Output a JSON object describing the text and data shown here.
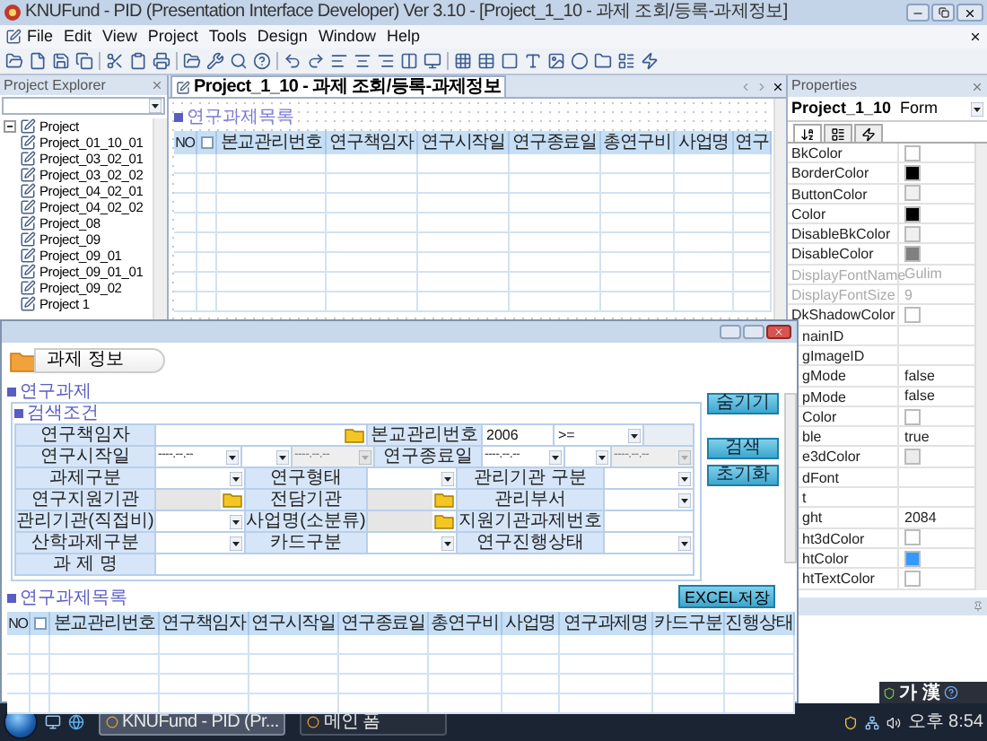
{
  "window": {
    "title": "KNUFund - PID (Presentation Interface Developer) Ver 3.10 - [Project_1_10 - 과제 조회/등록-과제정보]"
  },
  "menu": [
    "File",
    "Edit",
    "View",
    "Project",
    "Tools",
    "Design",
    "Window",
    "Help"
  ],
  "project_explorer": {
    "title": "Project Explorer",
    "tree": [
      {
        "label": "Project",
        "expanded": true,
        "children": [
          {
            "label": "Project_01_10_01"
          },
          {
            "label": "Project_03_02_01"
          },
          {
            "label": "Project_03_02_02"
          },
          {
            "label": "Project_04_02_01"
          },
          {
            "label": "Project_04_02_02"
          },
          {
            "label": "Project_08"
          },
          {
            "label": "Project_09"
          },
          {
            "label": "Project_09_01"
          },
          {
            "label": "Project_09_01_01"
          },
          {
            "label": "Project_09_02"
          },
          {
            "label": "Project 1"
          }
        ]
      }
    ]
  },
  "document": {
    "tab": "Project_1_10 - 과제 조회/등록-과제정보",
    "section_title": "연구과제목록",
    "table": {
      "select_all_checked": false,
      "columns": [
        "NO",
        "본교관리번호",
        "연구책임자",
        "연구시작일",
        "연구종료일",
        "총연구비",
        "사업명",
        "연구"
      ]
    }
  },
  "properties": {
    "title": "Properties",
    "object": "Project_1_10",
    "type": "Form",
    "rows": [
      {
        "name": "BkColor",
        "kind": "color",
        "color": "#ffffff"
      },
      {
        "name": "BorderColor",
        "kind": "color",
        "color": "#000000"
      },
      {
        "name": "ButtonColor",
        "kind": "color",
        "color": "#f0f0f0"
      },
      {
        "name": "Color",
        "kind": "color",
        "color": "#000000"
      },
      {
        "name": "DisableBkColor",
        "kind": "color",
        "color": "#f0f0f0"
      },
      {
        "name": "DisableColor",
        "kind": "color",
        "color": "#808080"
      },
      {
        "name": "DisplayFontName",
        "kind": "text",
        "value": "Gulim",
        "disabled": true
      },
      {
        "name": "DisplayFontSize",
        "kind": "text",
        "value": "9",
        "disabled": true
      },
      {
        "name": "DkShadowColor",
        "kind": "color",
        "color": "#ffffff"
      },
      {
        "name": "nainID",
        "kind": "text",
        "clipped": true
      },
      {
        "name": "gImageID",
        "kind": "text",
        "clipped": true
      },
      {
        "name": "gMode",
        "kind": "text",
        "value": "false",
        "clipped": true
      },
      {
        "name": "pMode",
        "kind": "text",
        "value": "false",
        "clipped": true
      },
      {
        "name": "Color",
        "kind": "color",
        "color": "#ffffff",
        "clipped": true
      },
      {
        "name": "ble",
        "kind": "text",
        "value": "true",
        "clipped": true
      },
      {
        "name": "e3dColor",
        "kind": "color",
        "color": "#ececec",
        "clipped": true
      },
      {
        "name": "dFont",
        "kind": "text",
        "clipped": true
      },
      {
        "name": "t",
        "kind": "text",
        "clipped": true
      },
      {
        "name": "ght",
        "kind": "text",
        "value": "2084",
        "clipped": true
      },
      {
        "name": "ht3dColor",
        "kind": "color",
        "color": "#ffffff",
        "clipped": true
      },
      {
        "name": "htColor",
        "kind": "color",
        "color": "#3399ff",
        "clipped": true
      },
      {
        "name": "htTextColor",
        "kind": "color",
        "color": "#ffffff",
        "clipped": true
      }
    ]
  },
  "dialog": {
    "header": "과제 정보",
    "section": "연구과제",
    "search_title": "검색조건",
    "form": [
      [
        {
          "kind": "label",
          "text": "연구책임자"
        },
        {
          "kind": "lookup"
        },
        {
          "kind": "label",
          "text": "본교관리번호"
        },
        {
          "kind": "input",
          "value": "2006"
        },
        {
          "kind": "select",
          "value": ">="
        },
        {
          "kind": "blank"
        }
      ],
      [
        {
          "kind": "label",
          "text": "연구시작일"
        },
        {
          "kind": "date",
          "value": "----.--.--"
        },
        {
          "kind": "select"
        },
        {
          "kind": "date",
          "value": "----.--.--",
          "disabled": true
        },
        {
          "kind": "label",
          "text": "연구종료일"
        },
        {
          "kind": "date",
          "value": "----.--.--"
        },
        {
          "kind": "select"
        },
        {
          "kind": "date",
          "value": "----.--.--",
          "disabled": true
        }
      ],
      [
        {
          "kind": "label",
          "text": "과제구분"
        },
        {
          "kind": "select"
        },
        {
          "kind": "label",
          "text": "연구형태"
        },
        {
          "kind": "select"
        },
        {
          "kind": "label",
          "text": "관리기관 구분"
        },
        {
          "kind": "select"
        }
      ],
      [
        {
          "kind": "label",
          "text": "연구지원기관"
        },
        {
          "kind": "lookup",
          "disabled": true
        },
        {
          "kind": "label",
          "text": "전담기관"
        },
        {
          "kind": "lookup",
          "disabled": true
        },
        {
          "kind": "label",
          "text": "관리부서"
        },
        {
          "kind": "select"
        }
      ],
      [
        {
          "kind": "label",
          "text": "관리기관(직접비)"
        },
        {
          "kind": "select"
        },
        {
          "kind": "label",
          "text": "사업명(소분류)"
        },
        {
          "kind": "lookup",
          "disabled": true
        },
        {
          "kind": "label",
          "text": "지원기관과제번호"
        },
        {
          "kind": "input"
        }
      ],
      [
        {
          "kind": "label",
          "text": "산학과제구분"
        },
        {
          "kind": "select"
        },
        {
          "kind": "label",
          "text": "카드구분"
        },
        {
          "kind": "select"
        },
        {
          "kind": "label",
          "text": "연구진행상태"
        },
        {
          "kind": "select"
        }
      ],
      [
        {
          "kind": "label",
          "text": "과 제 명"
        },
        {
          "kind": "input"
        }
      ]
    ],
    "buttons": [
      "숨기기",
      "검색",
      "초기화"
    ],
    "excel_button": "EXCEL저장",
    "list_title": "연구과제목록",
    "table": {
      "select_all_checked": false,
      "columns": [
        "NO",
        "본교관리번호",
        "연구책임자",
        "연구시작일",
        "연구종료일",
        "총연구비",
        "사업명",
        "연구과제명",
        "카드구분",
        "진행상태"
      ]
    }
  },
  "taskbar": {
    "tasks": [
      {
        "label": "KNUFund - PID (Pr...",
        "selected": true
      },
      {
        "label": "메인 폼",
        "selected": false
      }
    ],
    "ime": "가 漢",
    "clock": "오후 8:54"
  }
}
